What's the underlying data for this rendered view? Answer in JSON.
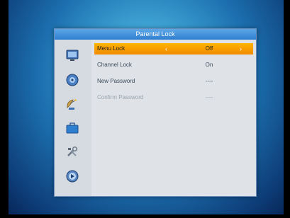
{
  "dialog": {
    "title": "Parental Lock"
  },
  "sidebar": {
    "icons": [
      "monitor-icon",
      "disc-icon",
      "satellite-dish-icon",
      "briefcase-icon",
      "tools-icon",
      "media-icon"
    ]
  },
  "settings": {
    "rows": [
      {
        "label": "Menu Lock",
        "value": "Off",
        "selected": true,
        "enabled": true
      },
      {
        "label": "Channel Lock",
        "value": "On",
        "selected": false,
        "enabled": true
      },
      {
        "label": "New Password",
        "value": "----",
        "selected": false,
        "enabled": true
      },
      {
        "label": "Confirm Password",
        "value": "----",
        "selected": false,
        "enabled": false
      }
    ],
    "left_arrow": "‹",
    "right_arrow": "›"
  },
  "colors": {
    "selection": "#f5a000",
    "title_bar": "#3f8fdc",
    "panel": "#d6dbe2"
  }
}
